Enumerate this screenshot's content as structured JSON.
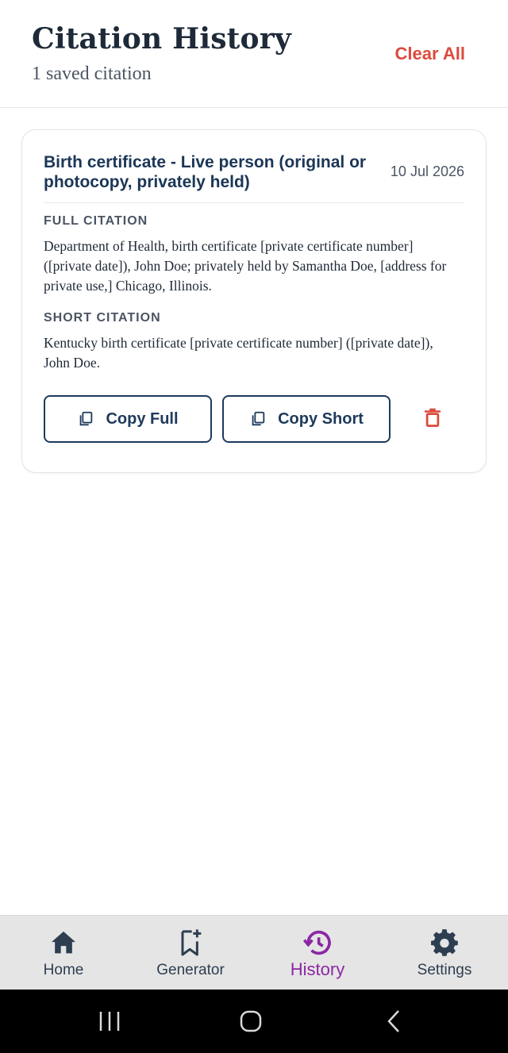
{
  "header": {
    "title": "Citation History",
    "subtitle": "1 saved citation",
    "clear_all_label": "Clear All"
  },
  "citations": [
    {
      "title": "Birth certificate - Live person (original or photocopy, privately held)",
      "date": "10 Jul 2026",
      "full_label": "FULL CITATION",
      "full_text": "Department of Health, birth certificate [private certificate number] ([private date]), John Doe; privately held by Samantha Doe, [address for private use,] Chicago, Illinois.",
      "short_label": "SHORT CITATION",
      "short_text": "Kentucky birth certificate [private certificate number] ([private date]), John Doe.",
      "copy_full_label": "Copy Full",
      "copy_short_label": "Copy Short",
      "copy_icon": "copy-icon",
      "delete_icon": "trash-icon"
    }
  ],
  "bottom_nav": {
    "items": [
      {
        "label": "Home",
        "icon": "home-icon",
        "active": false
      },
      {
        "label": "Generator",
        "icon": "bookmark-add-icon",
        "active": false
      },
      {
        "label": "History",
        "icon": "history-icon",
        "active": true
      },
      {
        "label": "Settings",
        "icon": "gear-icon",
        "active": false
      }
    ]
  },
  "system_nav": {
    "buttons": [
      "recent-apps-icon",
      "home-circle-icon",
      "back-icon"
    ]
  },
  "colors": {
    "accent_navy": "#1e3a5c",
    "danger": "#dc4a3d",
    "active_nav": "#8b27a4",
    "nav_background": "#e5e5e5"
  }
}
